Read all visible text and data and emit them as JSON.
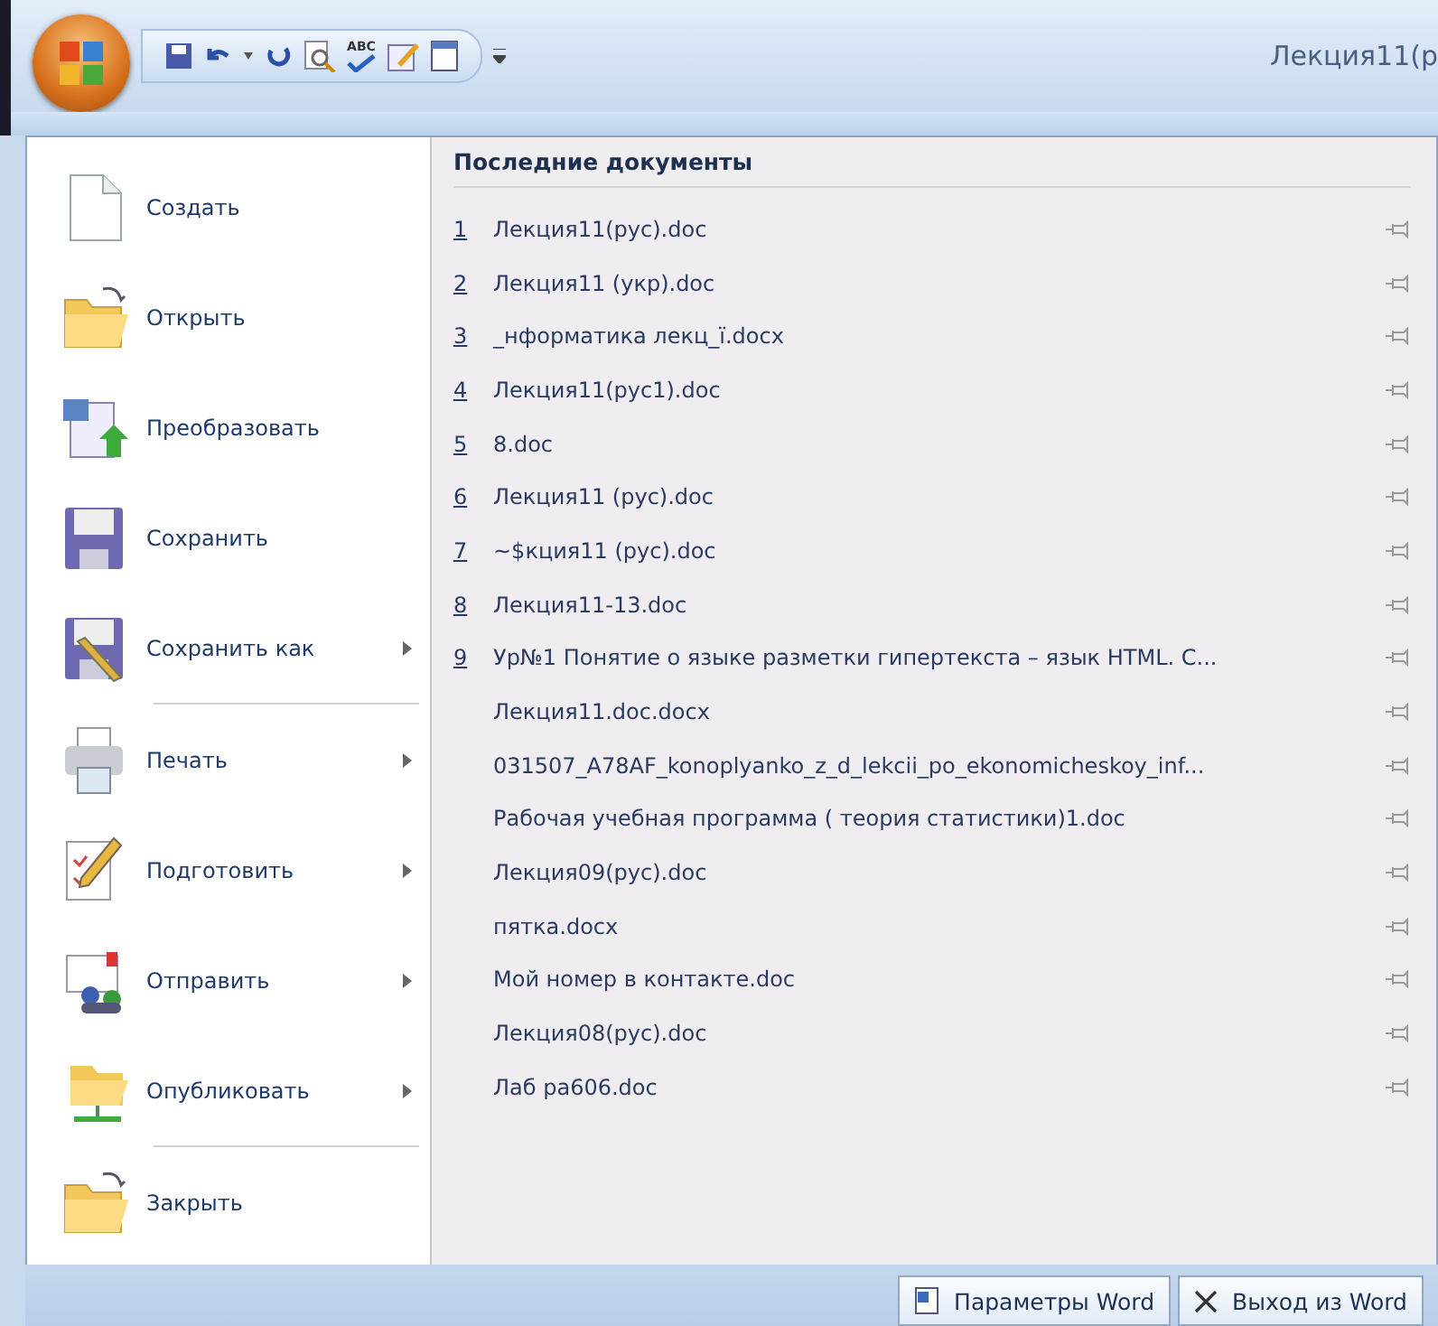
{
  "window": {
    "title": "Лекция11(р"
  },
  "quick_access": {
    "spell_label": "ABC"
  },
  "menu": {
    "items": [
      {
        "label": "Создать",
        "has_submenu": false,
        "separator_after": false
      },
      {
        "label": "Открыть",
        "has_submenu": false,
        "separator_after": false
      },
      {
        "label": "Преобразовать",
        "has_submenu": false,
        "separator_after": false
      },
      {
        "label": "Сохранить",
        "has_submenu": false,
        "separator_after": false
      },
      {
        "label": "Сохранить как",
        "has_submenu": true,
        "separator_after": true
      },
      {
        "label": "Печать",
        "has_submenu": true,
        "separator_after": false
      },
      {
        "label": "Подготовить",
        "has_submenu": true,
        "separator_after": false
      },
      {
        "label": "Отправить",
        "has_submenu": true,
        "separator_after": false
      },
      {
        "label": "Опубликовать",
        "has_submenu": true,
        "separator_after": true
      },
      {
        "label": "Закрыть",
        "has_submenu": false,
        "separator_after": false
      }
    ]
  },
  "recent": {
    "title": "Последние документы",
    "documents": [
      {
        "number": "1",
        "name": "Лекция11(рус).doc",
        "pinned": false
      },
      {
        "number": "2",
        "name": "Лекция11 (укр).doc",
        "pinned": false
      },
      {
        "number": "3",
        "name": "_нформатика лекц_ї.docx",
        "pinned": false
      },
      {
        "number": "4",
        "name": "Лекция11(рус1).doc",
        "pinned": false
      },
      {
        "number": "5",
        "name": "8.doc",
        "pinned": false
      },
      {
        "number": "6",
        "name": "Лекция11 (рус).doc",
        "pinned": false
      },
      {
        "number": "7",
        "name": "~$кция11 (рус).doc",
        "pinned": false
      },
      {
        "number": "8",
        "name": "Лекция11-13.doc",
        "pinned": false
      },
      {
        "number": "9",
        "name": "Ур№1 Понятие о языке разметки гипертекста – язык HTML. С...",
        "pinned": false
      },
      {
        "name": "Лекция11.doc.docx",
        "pinned": false
      },
      {
        "name": "031507_A78AF_konoplyanko_z_d_lekcii_po_ekonomicheskoy_inf...",
        "pinned": false
      },
      {
        "name": "Рабочая учебная программа  ( теория статистики)1.doc",
        "pinned": false
      },
      {
        "name": "Лекция09(рус).doc",
        "pinned": false
      },
      {
        "name": "пятка.docx",
        "pinned": false
      },
      {
        "name": "Мой номер в контакте.doc",
        "pinned": false
      },
      {
        "name": "Лекция08(рус).doc",
        "pinned": false
      },
      {
        "name": "Лаб  ра606.doc",
        "pinned": false
      }
    ]
  },
  "footer": {
    "buttons": [
      {
        "kind": "options",
        "label": "Параметры Word"
      },
      {
        "kind": "exit",
        "label": "Выход из Word"
      }
    ]
  }
}
